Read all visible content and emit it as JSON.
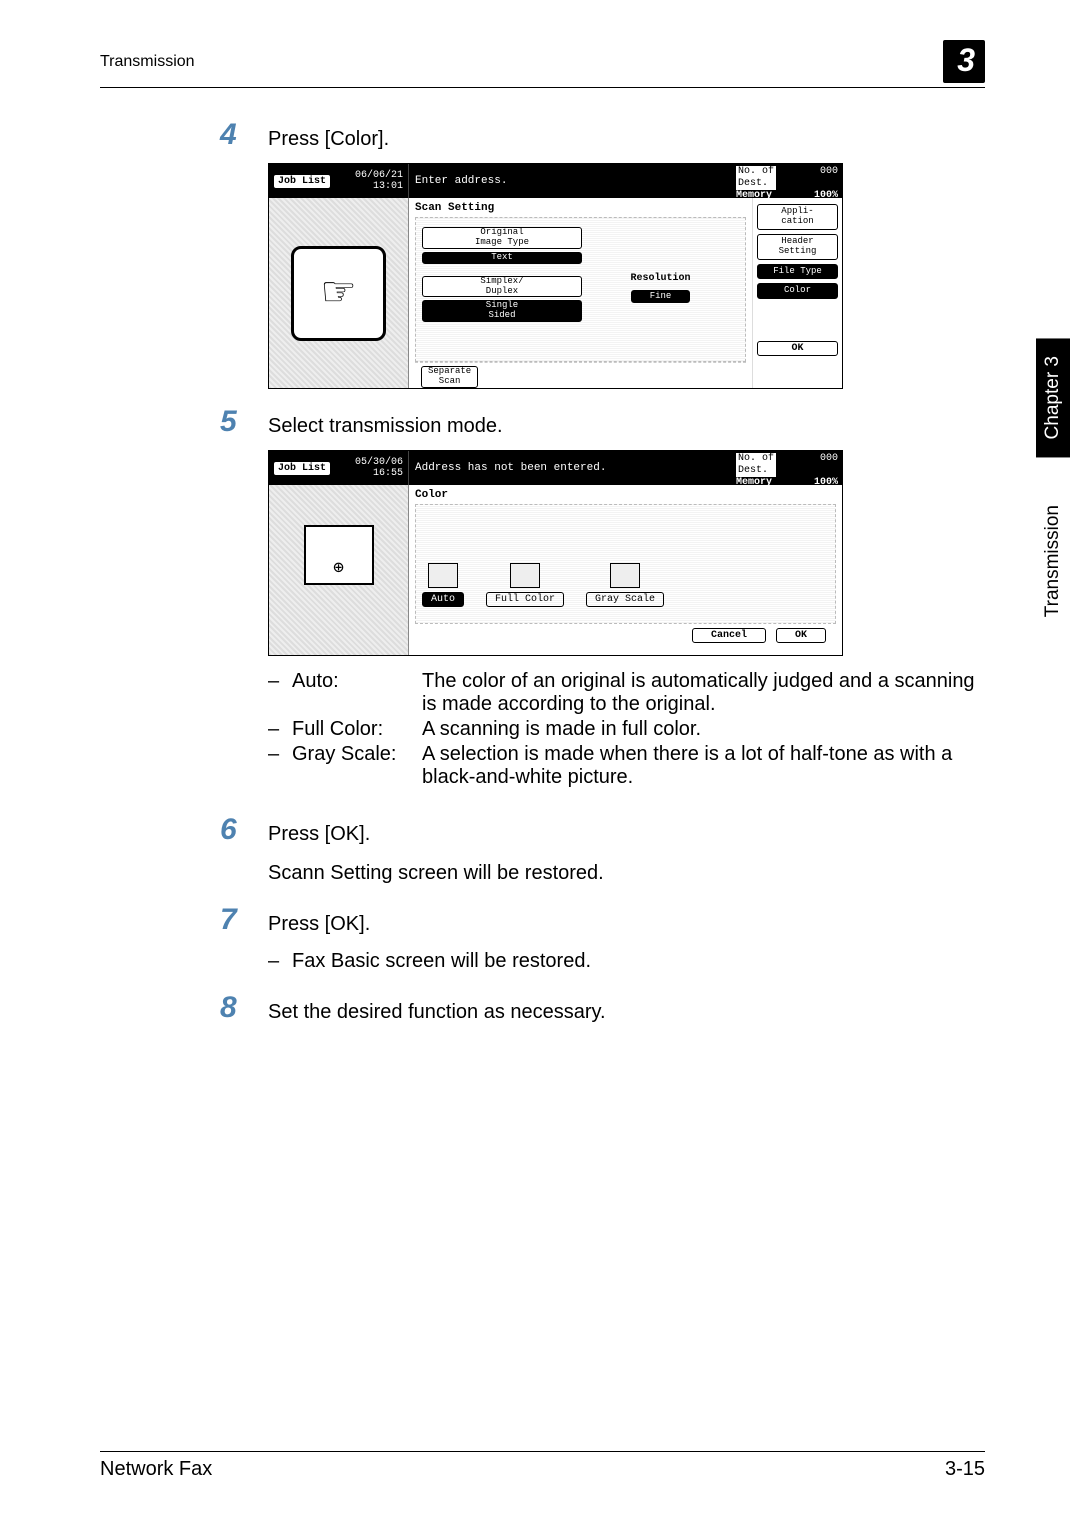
{
  "header": {
    "title": "Transmission",
    "chapterNumber": "3"
  },
  "sideTabs": {
    "chapter": "Chapter 3",
    "section": "Transmission"
  },
  "steps": {
    "s4": {
      "num": "4",
      "text": "Press [Color]."
    },
    "s5": {
      "num": "5",
      "text": "Select transmission mode."
    },
    "s6": {
      "num": "6",
      "text": "Press [OK].",
      "sub": "Scann Setting screen will be restored."
    },
    "s7": {
      "num": "7",
      "text": "Press [OK].",
      "bullet": "Fax Basic screen will be restored."
    },
    "s8": {
      "num": "8",
      "text": "Set the desired function as necessary."
    }
  },
  "screenshot1": {
    "jobList": "Job\nList",
    "date": "06/06/21\n13:01",
    "message": "Enter address.",
    "destLabel": "No. of\nDest.",
    "destVal": "000",
    "memLabel": "Memory",
    "memVal": "100%",
    "section": "Scan Setting",
    "origLabel": "Original\nImage Type",
    "origVal": "Text",
    "simplexLabel": "Simplex/\nDuplex",
    "simplexVal": "Single\nSided",
    "resLabel": "Resolution",
    "resVal": "Fine",
    "sepScan": "Separate\nScan",
    "rButtons": {
      "appli": "Appli-\ncation",
      "header": "Header\nSetting",
      "fileType": "File Type",
      "color": "Color"
    },
    "ok": "OK"
  },
  "screenshot2": {
    "jobList": "Job\nList",
    "date": "05/30/06\n16:55",
    "message": "Address has not been entered.",
    "destLabel": "No. of\nDest.",
    "destVal": "000",
    "memLabel": "Memory",
    "memVal": "100%",
    "section": "Color",
    "opts": {
      "auto": "Auto",
      "full": "Full Color",
      "gray": "Gray Scale"
    },
    "cancel": "Cancel",
    "ok": "OK"
  },
  "definitions": {
    "auto": {
      "label": "Auto:",
      "desc": "The color of an original is automatically judged and a scanning is made according to the original."
    },
    "full": {
      "label": "Full Color:",
      "desc": "A scanning is made in full color."
    },
    "gray": {
      "label": "Gray Scale:",
      "desc": "A selection is made when there is a lot of half-tone as with a black-and-white picture."
    }
  },
  "footer": {
    "left": "Network Fax",
    "right": "3-15"
  }
}
